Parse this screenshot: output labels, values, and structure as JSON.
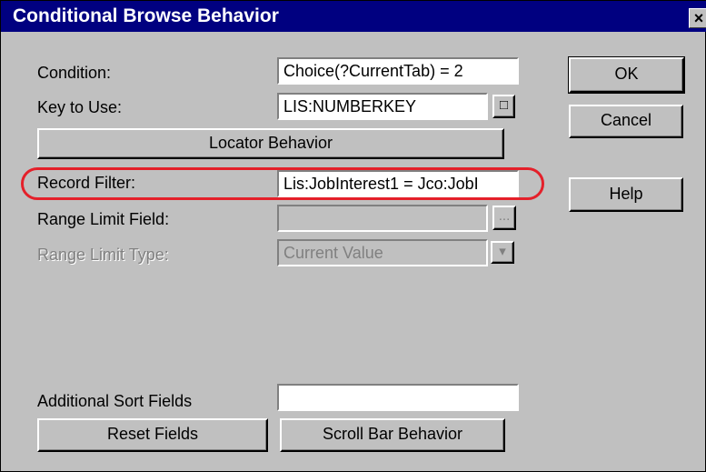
{
  "window": {
    "title": "Conditional Browse Behavior",
    "close_glyph": "×"
  },
  "fields": {
    "condition": {
      "label": "Condition:",
      "value": "Choice(?CurrentTab) = 2"
    },
    "key_to_use": {
      "label": "Key to Use:",
      "value": "LIS:NUMBERKEY",
      "lookup_glyph": "□"
    },
    "record_filter": {
      "label": "Record Filter:",
      "value": "Lis:JobInterest1 = Jco:JobI"
    },
    "range_limit_field": {
      "label": "Range Limit Field:",
      "value": "",
      "lookup_glyph": "..."
    },
    "range_limit_type": {
      "label": "Range Limit Type:",
      "value": "Current Value",
      "dropdown_glyph": "▾"
    },
    "additional_sort_fields": {
      "label": "Additional Sort Fields",
      "value": ""
    }
  },
  "buttons": {
    "locator_behavior": "Locator Behavior",
    "reset_fields": "Reset Fields",
    "scroll_bar_behavior": "Scroll Bar Behavior",
    "ok": "OK",
    "cancel": "Cancel",
    "help": "Help"
  },
  "highlight_color": "#e4202a"
}
